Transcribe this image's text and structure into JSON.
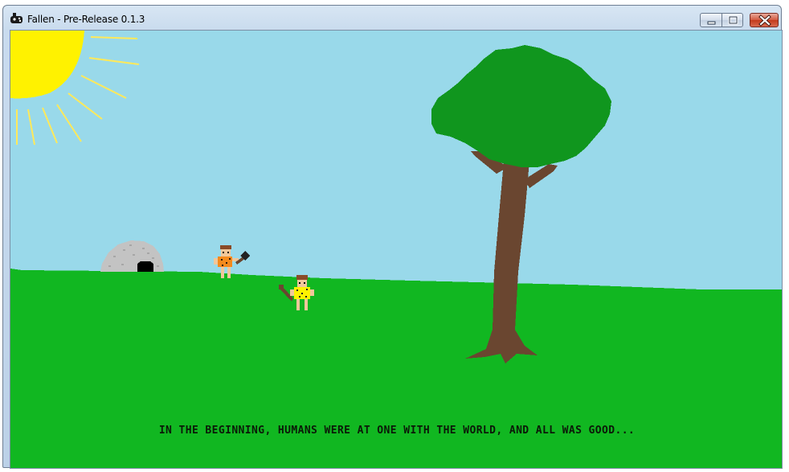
{
  "window": {
    "title": "Fallen - Pre-Release 0.1.3",
    "app_icon": "game-controller-icon",
    "controls": [
      "minimize-icon",
      "maximize-icon",
      "close-icon"
    ]
  },
  "scene": {
    "caption": "IN THE BEGINNING, HUMANS WERE AT ONE WITH THE WORLD, AND ALL WAS GOOD...",
    "colors": {
      "sky": "#99d9ea",
      "grass": "#11b721",
      "sun": "#fff200",
      "tree_leaves": "#10961e",
      "tree_trunk": "#6a4630",
      "cave": "#c3c3c3"
    }
  }
}
